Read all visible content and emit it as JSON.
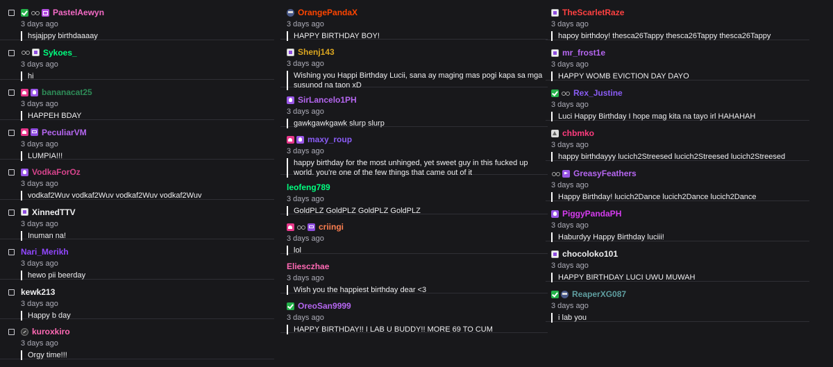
{
  "columns": [
    {
      "comments": [
        {
          "badges": [
            "green-check-icon",
            "glasses-icon",
            "gift-icon"
          ],
          "username": "PastelAewyn",
          "color": "#f36ac5",
          "time": "3 days ago",
          "text": "hsjajppy birthdaaaay",
          "checkbox": true
        },
        {
          "badges": [
            "glasses-icon",
            "subscriber-icon"
          ],
          "username": "Sykoes_",
          "color": "#00ff7f",
          "time": "3 days ago",
          "text": "hi",
          "checkbox": true
        },
        {
          "badges": [
            "pink-heart-icon",
            "purple-drop-icon"
          ],
          "username": "bananacat25",
          "color": "#2e8b57",
          "time": "3 days ago",
          "text": "HAPPEH BDAY",
          "checkbox": true
        },
        {
          "badges": [
            "pink-heart-icon",
            "subscriber-gift-icon"
          ],
          "username": "PeculiarVM",
          "color": "#b566f0",
          "time": "3 days ago",
          "text": "LUMPIA!!!",
          "checkbox": true
        },
        {
          "badges": [
            "purple-drop-icon"
          ],
          "username": "VodkaForOz",
          "color": "#d6448c",
          "time": "3 days ago",
          "text": "vodkaf2Wuv vodkaf2Wuv vodkaf2Wuv vodkaf2Wuv",
          "checkbox": true
        },
        {
          "badges": [
            "subscriber-icon"
          ],
          "username": "XinnedTTV",
          "color": "#efeff1",
          "time": "3 days ago",
          "text": "Inuman na!",
          "checkbox": true
        },
        {
          "badges": [],
          "username": "Nari_Merikh",
          "color": "#9147ff",
          "time": "3 days ago",
          "text": "hewo pii beerday",
          "checkbox": true
        },
        {
          "badges": [],
          "username": "kewk213",
          "color": "#efeff1",
          "time": "3 days ago",
          "text": "Happy b day",
          "checkbox": true
        },
        {
          "badges": [
            "no-audio-icon"
          ],
          "username": "kuroxkiro",
          "color": "#ff69b4",
          "time": "3 days ago",
          "text": "Orgy time!!!",
          "checkbox": true
        }
      ]
    },
    {
      "comments": [
        {
          "badges": [
            "ninja-icon"
          ],
          "username": "OrangePandaX",
          "color": "#ff4500",
          "time": "3 days ago",
          "text": "HAPPY BIRTHDAY BOY!",
          "checkbox": false
        },
        {
          "badges": [
            "subscriber-icon"
          ],
          "username": "Shenj143",
          "color": "#daa520",
          "time": "3 days ago",
          "text": "Wishing you Happi Birthday Lucii, sana ay maging mas pogi kapa sa mga susunod na taon xD",
          "checkbox": false
        },
        {
          "badges": [
            "purple-drop-icon"
          ],
          "username": "SirLancelo1PH",
          "color": "#b566f0",
          "time": "3 days ago",
          "text": "gawkgawkgawk slurp slurp",
          "checkbox": false
        },
        {
          "badges": [
            "pink-heart-icon",
            "purple-drop-icon"
          ],
          "username": "maxy_roup",
          "color": "#8a5cf5",
          "time": "3 days ago",
          "text": "happy birthday for the most unhinged, yet sweet guy in this fucked up world. you're one of the few things that came out of it",
          "checkbox": false
        },
        {
          "badges": [],
          "username": "leofeng789",
          "color": "#00ff7f",
          "time": "3 days ago",
          "text": "GoldPLZ GoldPLZ GoldPLZ GoldPLZ",
          "checkbox": false
        },
        {
          "badges": [
            "pink-heart-icon",
            "glasses-icon",
            "subscriber-gift-icon"
          ],
          "username": "criingi",
          "color": "#ff7f50",
          "time": "3 days ago",
          "text": "lol",
          "checkbox": false
        },
        {
          "badges": [],
          "username": "Eliesczhae",
          "color": "#ff69b4",
          "time": "3 days ago",
          "text": "Wish you the happiest birthday dear <3",
          "checkbox": false
        },
        {
          "badges": [
            "green-check-icon"
          ],
          "username": "OreoSan9999",
          "color": "#b566f0",
          "time": "3 days ago",
          "text": "HAPPY BIRTHDAY!! I LAB U BUDDY!! MORE 69 TO CUM",
          "checkbox": false
        }
      ]
    },
    {
      "comments": [
        {
          "badges": [
            "subscriber-icon"
          ],
          "username": "TheScarletRaze",
          "color": "#ff4141",
          "time": "3 days ago",
          "text": "hapoy birthdoy! thesca26Tappy thesca26Tappy thesca26Tappy",
          "checkbox": false
        },
        {
          "badges": [
            "subscriber-icon"
          ],
          "username": "mr_frost1e",
          "color": "#b566f0",
          "time": "3 days ago",
          "text": "HAPPY WOMB EVICTION DAY DAYO",
          "checkbox": false
        },
        {
          "badges": [
            "green-check-icon",
            "glasses-icon"
          ],
          "username": "Rex_Justine",
          "color": "#8a5cf5",
          "time": "3 days ago",
          "text": "Luci Happy Birthday I hope mag kita na tayo irl HAHAHAH",
          "checkbox": false
        },
        {
          "badges": [
            "gray-triangle-icon"
          ],
          "username": "chbmko",
          "color": "#ff3c7f",
          "time": "3 days ago",
          "text": "happy birthdayyy lucich2Streesed lucich2Streesed lucich2Streesed",
          "checkbox": false
        },
        {
          "badges": [
            "glasses-icon",
            "hype-play-icon"
          ],
          "username": "GreasyFeathers",
          "color": "#b566f0",
          "time": "3 days ago",
          "text": "Happy Birthday! lucich2Dance lucich2Dance lucich2Dance",
          "checkbox": false
        },
        {
          "badges": [
            "purple-drop-icon"
          ],
          "username": "PiggyPandaPH",
          "color": "#d63cf0",
          "time": "3 days ago",
          "text": "Haburdyy Happy Birthday luciii!",
          "checkbox": false
        },
        {
          "badges": [
            "subscriber-icon"
          ],
          "username": "chocoloko101",
          "color": "#efeff1",
          "time": "3 days ago",
          "text": "HAPPY BIRTHDAY LUCI UWU MUWAH",
          "checkbox": false
        },
        {
          "badges": [
            "green-check-icon",
            "ninja-icon"
          ],
          "username": "ReaperXG087",
          "color": "#5f9ea0",
          "time": "3 days ago",
          "text": "i lab you",
          "checkbox": false
        }
      ]
    }
  ]
}
